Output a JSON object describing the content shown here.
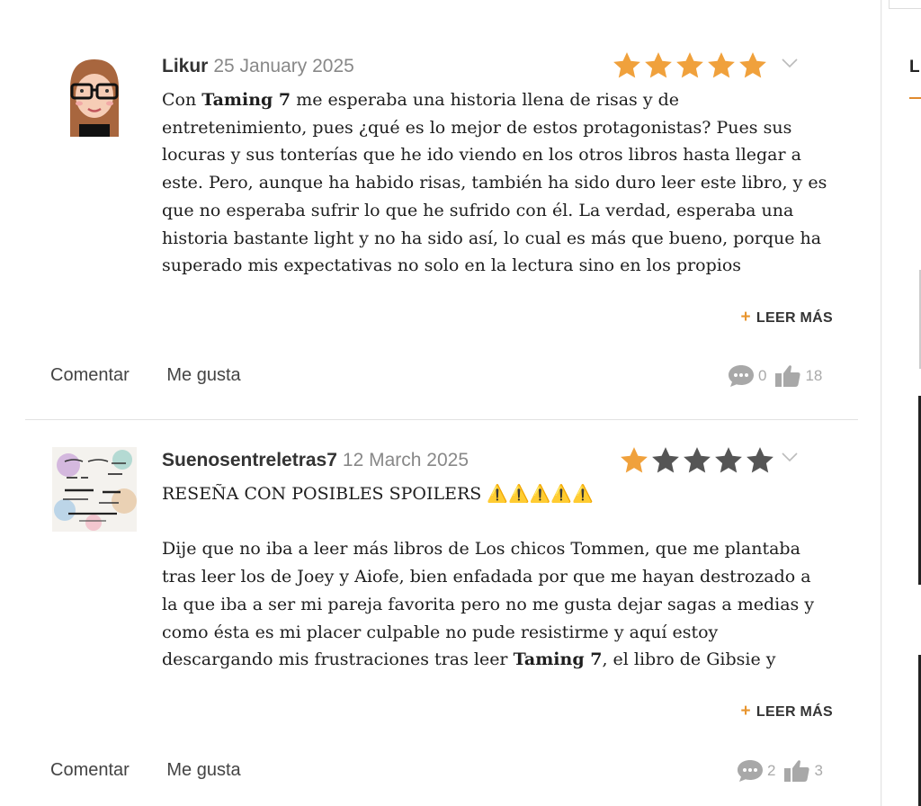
{
  "reviews": [
    {
      "user": "Likur",
      "date": "25 January 2025",
      "rating": 5,
      "body_lines": [
        [
          "Con ",
          "Taming 7",
          " me esperaba una historia llena de risas y de"
        ],
        "entretenimiento, pues ¿qué es lo mejor de estos protagonistas? Pues sus",
        "locuras y sus tonterías que he ido viendo en los otros libros hasta llegar a",
        "este. Pero, aunque ha habido risas, también ha sido duro leer este libro, y es",
        "que no esperaba sufrir lo que he sufrido con él. La verdad, esperaba una",
        "historia bastante light y no ha sido así, lo cual es más que bueno, porque ha",
        "superado mis expectativas no solo en la lectura sino en los propios"
      ],
      "read_more": "LEER MÁS",
      "comment_label": "Comentar",
      "like_label": "Me gusta",
      "comment_count": "0",
      "like_count": "18"
    },
    {
      "user": "Suenosentreletras7",
      "date": "12 March 2025",
      "rating": 1,
      "title_line": "RESEÑA CON POSIBLES SPOILERS ⚠️⚠️⚠️⚠️⚠️",
      "body_lines": [
        "Dije que no iba a leer más libros de Los chicos Tommen, que me plantaba",
        "tras leer los de Joey y Aiofe, bien enfadada por que me hayan destrozado a",
        "la que iba a ser mi pareja favorita pero no me gusta dejar sagas a medias y",
        "como ésta es mi placer culpable no pude resistirme y aquí estoy",
        [
          "descargando mis frustraciones tras leer ",
          "Taming 7",
          ", el libro de Gibsie y"
        ]
      ],
      "read_more": "LEER MÁS",
      "comment_label": "Comentar",
      "like_label": "Me gusta",
      "comment_count": "2",
      "like_count": "3"
    }
  ],
  "sidebar": {
    "letter": "L"
  },
  "colors": {
    "star_on": "#f0a13c",
    "star_off": "#555555",
    "accent": "#e8952f"
  }
}
